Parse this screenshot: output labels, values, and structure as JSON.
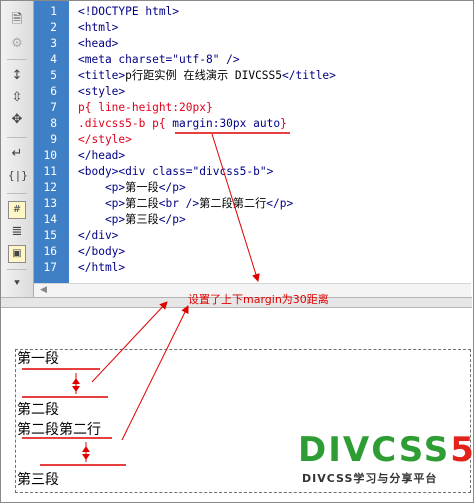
{
  "toolbar": {
    "icons": [
      "new-file-icon",
      "settings-icon",
      "expand-icon",
      "collapse-icon",
      "select-icon",
      "indent-icon",
      "braces-icon",
      "snippet-icon",
      "format-icon",
      "image-icon",
      "chevron-down-icon"
    ]
  },
  "editor": {
    "line_numbers": [
      "1",
      "2",
      "3",
      "4",
      "5",
      "6",
      "7",
      "8",
      "9",
      "10",
      "11",
      "12",
      "13",
      "14",
      "15",
      "16",
      "17"
    ],
    "lines": [
      {
        "segments": [
          {
            "text": "<!DOCTYPE html>",
            "cls": "tag"
          }
        ]
      },
      {
        "segments": [
          {
            "text": "<html>",
            "cls": "tag"
          }
        ]
      },
      {
        "segments": [
          {
            "text": "<head>",
            "cls": "tag"
          }
        ]
      },
      {
        "segments": [
          {
            "text": "<meta charset=\"utf-8\" />",
            "cls": "tag"
          }
        ]
      },
      {
        "segments": [
          {
            "text": "<title>",
            "cls": "tag"
          },
          {
            "text": "p行距实例 在线演示 DIVCSS5",
            "cls": "txt"
          },
          {
            "text": "</title>",
            "cls": "tag"
          }
        ]
      },
      {
        "segments": [
          {
            "text": "<style>",
            "cls": "tag"
          }
        ]
      },
      {
        "segments": [
          {
            "text": "p{ line-height:20px}",
            "cls": "red"
          }
        ]
      },
      {
        "segments": [
          {
            "text": ".divcss5-b p{ ",
            "cls": "red"
          },
          {
            "text": "margin:30px auto",
            "cls": "tag"
          },
          {
            "text": "}",
            "cls": "red"
          }
        ]
      },
      {
        "segments": [
          {
            "text": "</style>",
            "cls": "red"
          }
        ]
      },
      {
        "segments": [
          {
            "text": "</head>",
            "cls": "tag"
          }
        ]
      },
      {
        "segments": [
          {
            "text": "<body><div class=\"divcss5-b\">",
            "cls": "tag"
          }
        ]
      },
      {
        "segments": [
          {
            "text": "    <p>",
            "cls": "tag"
          },
          {
            "text": "第一段",
            "cls": "txt"
          },
          {
            "text": "</p>",
            "cls": "tag"
          }
        ]
      },
      {
        "segments": [
          {
            "text": "    <p>",
            "cls": "tag"
          },
          {
            "text": "第二段",
            "cls": "txt"
          },
          {
            "text": "<br />",
            "cls": "tag"
          },
          {
            "text": "第二段第二行",
            "cls": "txt"
          },
          {
            "text": "</p>",
            "cls": "tag"
          }
        ]
      },
      {
        "segments": [
          {
            "text": "    <p>",
            "cls": "tag"
          },
          {
            "text": "第三段",
            "cls": "txt"
          },
          {
            "text": "</p>",
            "cls": "tag"
          }
        ]
      },
      {
        "segments": [
          {
            "text": "</div>",
            "cls": "tag"
          }
        ]
      },
      {
        "segments": [
          {
            "text": "</body>",
            "cls": "tag"
          }
        ]
      },
      {
        "segments": [
          {
            "text": "</html>",
            "cls": "tag"
          }
        ]
      }
    ]
  },
  "annotation": "设置了上下margin为30距离",
  "preview": {
    "paragraphs": [
      "第一段",
      "第二段",
      "第二段第二行",
      "第三段"
    ]
  },
  "logo": {
    "div": "DIV",
    "css": "CSS",
    "five": "5",
    "tagline": "DIVCSS学习与分享平台"
  },
  "colors": {
    "gutter": "#3f7fc6",
    "tag": "#000085",
    "css_red": "#e0001b",
    "annotation_red": "#e00000",
    "logo_green": "#2e9e34",
    "logo_red": "#e2231a"
  }
}
